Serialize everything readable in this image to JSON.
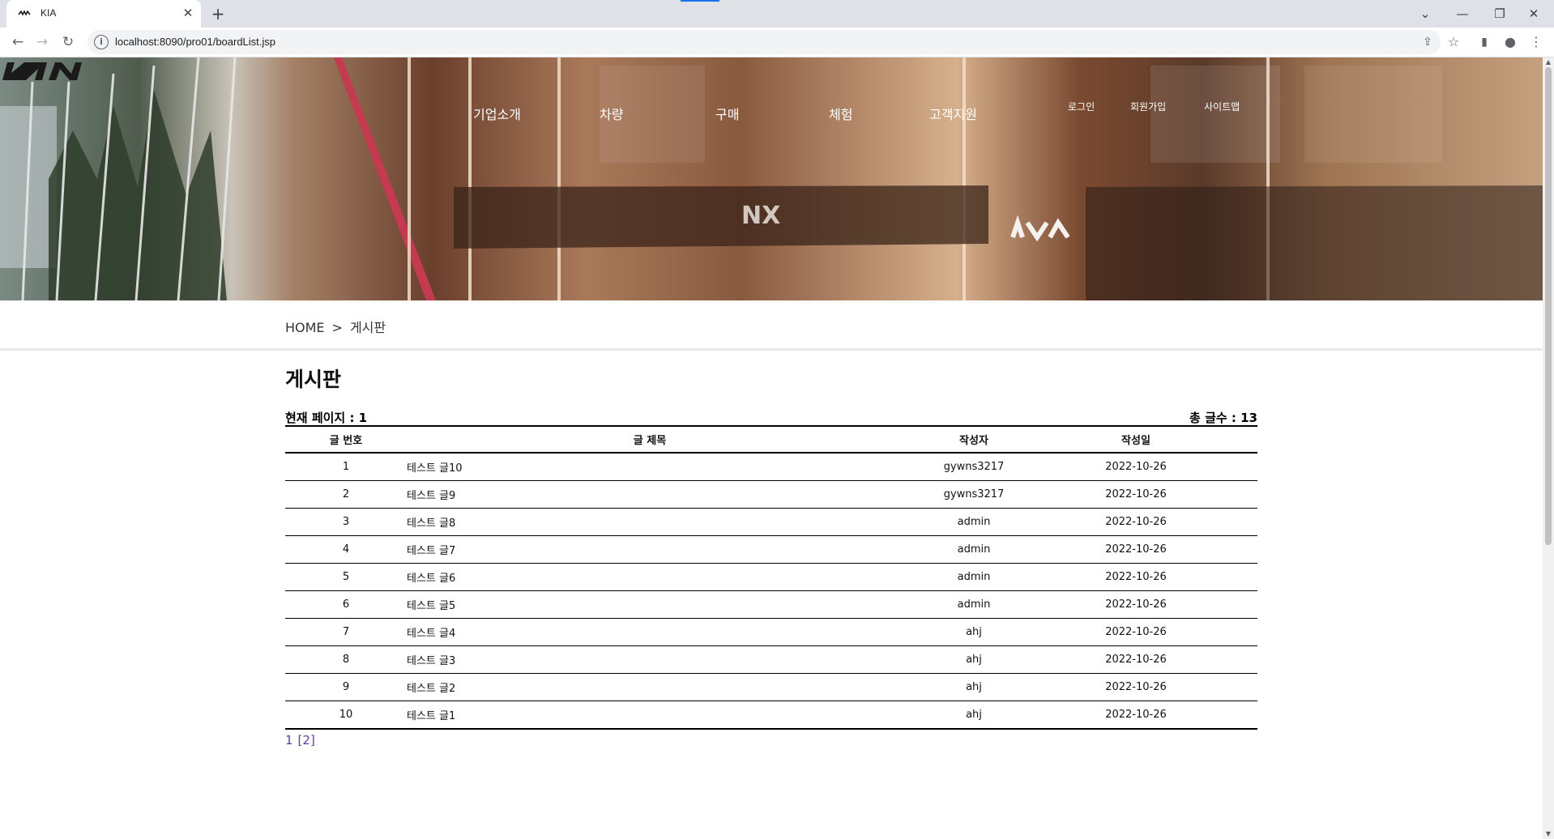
{
  "browser": {
    "tab_title": "KIA",
    "tab_close": "✕",
    "new_tab": "+",
    "url": "localhost:8090/pro01/boardList.jsp"
  },
  "header": {
    "logo_text": "KIA",
    "nav": [
      "기업소개",
      "차량",
      "구매",
      "체험",
      "고객지원"
    ],
    "util": [
      "로그인",
      "회원가입",
      "사이트맵"
    ]
  },
  "breadcrumb": {
    "home": "HOME",
    "separator": ">",
    "current": "게시판"
  },
  "board": {
    "heading": "게시판",
    "current_page_label": "현재 페이지 : 1",
    "total_count_label": "총 글수 : 13",
    "columns": [
      "글 번호",
      "글 제목",
      "작성자",
      "작성일"
    ],
    "rows": [
      [
        "1",
        "테스트 글10",
        "gywns3217",
        "2022-10-26"
      ],
      [
        "2",
        "테스트 글9",
        "gywns3217",
        "2022-10-26"
      ],
      [
        "3",
        "테스트 글8",
        "admin",
        "2022-10-26"
      ],
      [
        "4",
        "테스트 글7",
        "admin",
        "2022-10-26"
      ],
      [
        "5",
        "테스트 글6",
        "admin",
        "2022-10-26"
      ],
      [
        "6",
        "테스트 글5",
        "admin",
        "2022-10-26"
      ],
      [
        "7",
        "테스트 글4",
        "ahj",
        "2022-10-26"
      ],
      [
        "8",
        "테스트 글3",
        "ahj",
        "2022-10-26"
      ],
      [
        "9",
        "테스트 글2",
        "ahj",
        "2022-10-26"
      ],
      [
        "10",
        "테스트 글1",
        "ahj",
        "2022-10-26"
      ]
    ],
    "pagination": {
      "current": "1",
      "pages": [
        "[2]"
      ]
    }
  },
  "colors": {
    "page_link": "#5a3fa0",
    "table_rule": "#000000"
  }
}
